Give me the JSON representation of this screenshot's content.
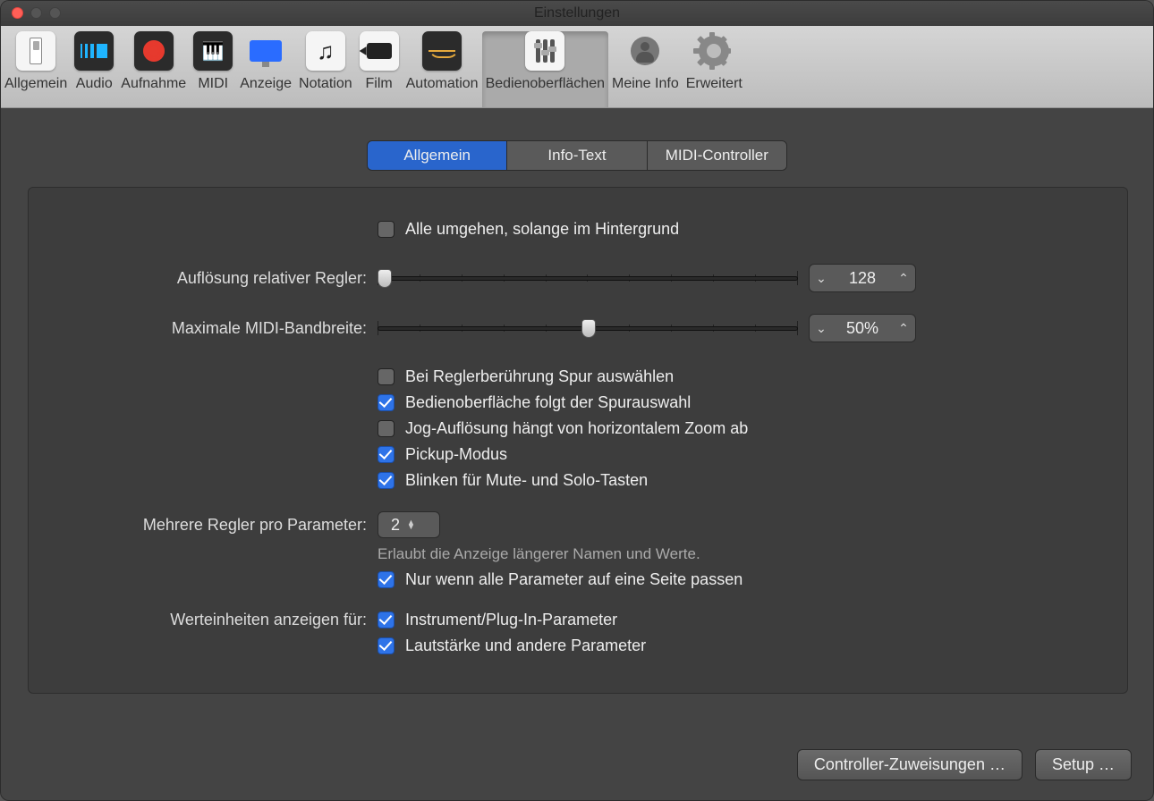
{
  "window": {
    "title": "Einstellungen"
  },
  "toolbar": {
    "items": [
      {
        "label": "Allgemein"
      },
      {
        "label": "Audio"
      },
      {
        "label": "Aufnahme"
      },
      {
        "label": "MIDI"
      },
      {
        "label": "Anzeige"
      },
      {
        "label": "Notation"
      },
      {
        "label": "Film"
      },
      {
        "label": "Automation"
      },
      {
        "label": "Bedienoberflächen"
      },
      {
        "label": "Meine Info"
      },
      {
        "label": "Erweitert"
      }
    ]
  },
  "tabs": {
    "general": "Allgemein",
    "tooltip": "Info-Text",
    "midi": "MIDI-Controller"
  },
  "settings": {
    "bypass_bg": "Alle umgehen, solange im Hintergrund",
    "res_label": "Auflösung relativer Regler:",
    "res_value": "128",
    "bw_label": "Maximale MIDI-Bandbreite:",
    "bw_value": "50%",
    "cb_touch": "Bei Reglerberührung Spur auswählen",
    "cb_follow": "Bedienoberfläche folgt der Spurauswahl",
    "cb_jog": "Jog-Auflösung hängt von horizontalem Zoom ab",
    "cb_pickup": "Pickup-Modus",
    "cb_blink": "Blinken für Mute- und Solo-Tasten",
    "multi_label": "Mehrere Regler pro Parameter:",
    "multi_value": "2",
    "multi_hint": "Erlaubt die Anzeige längerer Namen und Werte.",
    "cb_onlyfit": "Nur wenn alle Parameter auf eine Seite passen",
    "units_label": "Werteinheiten anzeigen für:",
    "cb_instr": "Instrument/Plug-In-Parameter",
    "cb_vol": "Lautstärke und andere Parameter"
  },
  "footer": {
    "assignments": "Controller-Zuweisungen …",
    "setup": "Setup …"
  }
}
